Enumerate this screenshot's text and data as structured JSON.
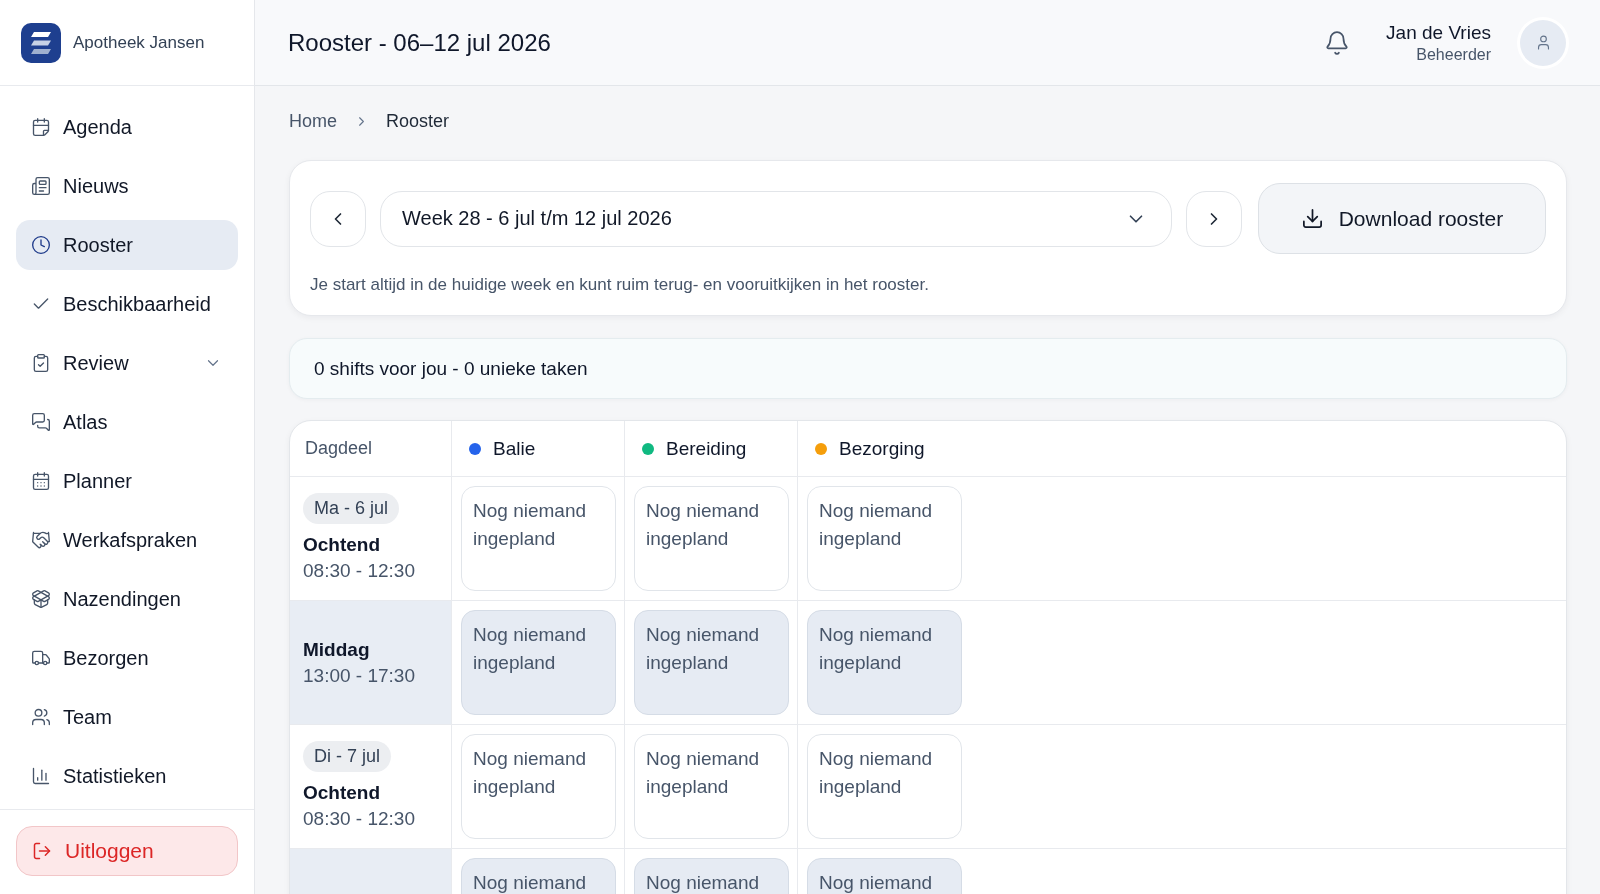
{
  "sidebar": {
    "brand": "Apotheek Jansen",
    "items": [
      {
        "label": "Agenda",
        "kind": "link",
        "selected": false
      },
      {
        "label": "Nieuws",
        "kind": "link",
        "selected": false
      },
      {
        "label": "Rooster",
        "kind": "link",
        "selected": true
      },
      {
        "label": "Beschikbaarheid",
        "kind": "link",
        "selected": false
      },
      {
        "label": "Review",
        "kind": "group",
        "selected": false
      },
      {
        "label": "Atlas",
        "kind": "link",
        "selected": false
      },
      {
        "label": "Planner",
        "kind": "link",
        "selected": false
      },
      {
        "label": "Werkafspraken",
        "kind": "link",
        "selected": false
      },
      {
        "label": "Nazendingen",
        "kind": "link",
        "selected": false
      },
      {
        "label": "Bezorgen",
        "kind": "link",
        "selected": false
      },
      {
        "label": "Team",
        "kind": "link",
        "selected": false
      },
      {
        "label": "Statistieken",
        "kind": "link",
        "selected": false
      }
    ],
    "logout": "Uitloggen"
  },
  "header": {
    "title": "Rooster - 06–12 jul 2026",
    "user": {
      "name": "Jan de Vries",
      "role": "Beheerder"
    }
  },
  "breadcrumb": [
    {
      "label": "Home",
      "current": false
    },
    {
      "label": "Rooster",
      "current": true
    }
  ],
  "week_card": {
    "week": "Week 28 - 6 jul t/m 12 jul 2026",
    "download": "Download rooster",
    "hint": "Je start altijd in de huidige week en kunt ruim terug- en vooruitkijken in het rooster."
  },
  "summary": "0 shifts voor jou - 0 unieke taken",
  "schedule": {
    "columns": [
      {
        "label": "Dagdeel",
        "kind": "period"
      },
      {
        "label": "Balie",
        "kind": "task",
        "color": "#2563eb"
      },
      {
        "label": "Bereiding",
        "kind": "task",
        "color": "#10b981"
      },
      {
        "label": "Bezorging",
        "kind": "task",
        "color": "#f59e0b"
      }
    ],
    "rows": [
      {
        "day": "Ma - 6 jul",
        "period": "Ochtend",
        "time": "08:30 - 12:30",
        "shaded": false,
        "slots": [
          "Nog niemand ingepland",
          "Nog niemand ingepland",
          "Nog niemand ingepland"
        ]
      },
      {
        "period": "Middag",
        "time": "13:00 - 17:30",
        "shaded": true,
        "slots": [
          "Nog niemand ingepland",
          "Nog niemand ingepland",
          "Nog niemand ingepland"
        ]
      },
      {
        "day": "Di - 7 jul",
        "period": "Ochtend",
        "time": "08:30 - 12:30",
        "shaded": false,
        "slots": [
          "Nog niemand ingepland",
          "Nog niemand ingepland",
          "Nog niemand ingepland"
        ]
      },
      {
        "shaded": true,
        "slots": [
          "Nog niemand",
          "Nog niemand",
          "Nog niemand"
        ]
      }
    ]
  }
}
